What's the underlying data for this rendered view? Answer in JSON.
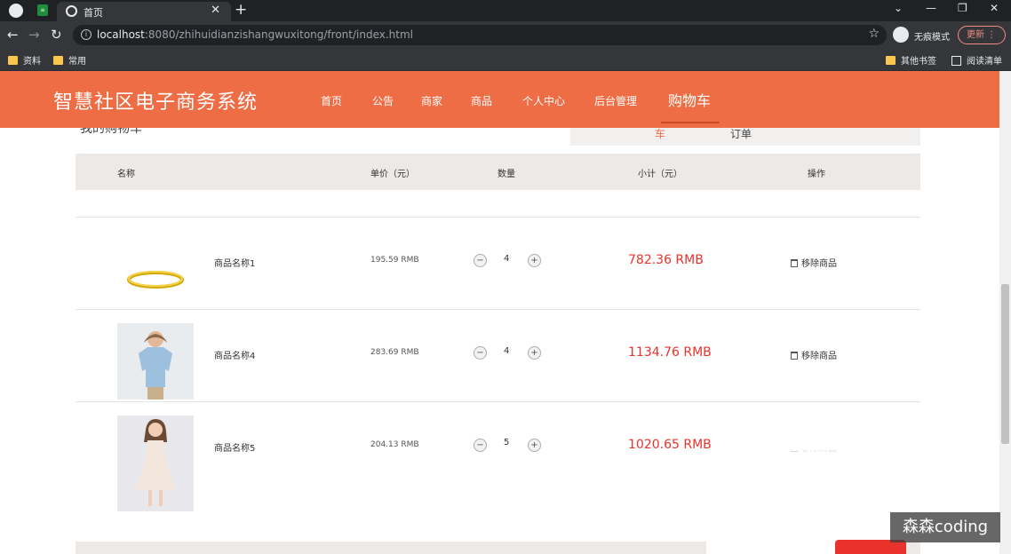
{
  "browser": {
    "tab_title": "首页",
    "url_host": "localhost",
    "url_rest": ":8080/zhihuidianzishangwuxitong/front/index.html",
    "incognito_label": "无痕模式",
    "update_label": "更新",
    "bookmarks": [
      "资料",
      "常用"
    ],
    "bookmarks_right": [
      "其他书签",
      "阅读清单"
    ]
  },
  "site": {
    "title": "智慧社区电子商务系统",
    "nav": [
      "首页",
      "公告",
      "商家",
      "商品",
      "个人中心",
      "后台管理",
      "购物车"
    ],
    "active_nav": "购物车",
    "accent_color": "#ef6d45"
  },
  "cart": {
    "heading": "我的购物车",
    "tabs": [
      "车",
      "订单"
    ],
    "columns": {
      "name": "名称",
      "unit_price": "单价（元）",
      "quantity": "数量",
      "subtotal": "小计（元）",
      "action": "操作"
    },
    "remove_label": "移除商品",
    "items": [
      {
        "image": "gold-bracelet",
        "name": "商品名称1",
        "unit_price": "195.59 RMB",
        "quantity": "4",
        "subtotal": "782.36 RMB"
      },
      {
        "image": "man-blue-polo",
        "name": "商品名称4",
        "unit_price": "283.69 RMB",
        "quantity": "4",
        "subtotal": "1134.76 RMB"
      },
      {
        "image": "woman-white-dress",
        "name": "商品名称5",
        "unit_price": "204.13 RMB",
        "quantity": "5",
        "subtotal": "1020.65 RMB"
      }
    ]
  },
  "watermark": "森森coding",
  "colors": {
    "subtotal": "#e8322b",
    "header_bg": "#ef6d45"
  }
}
